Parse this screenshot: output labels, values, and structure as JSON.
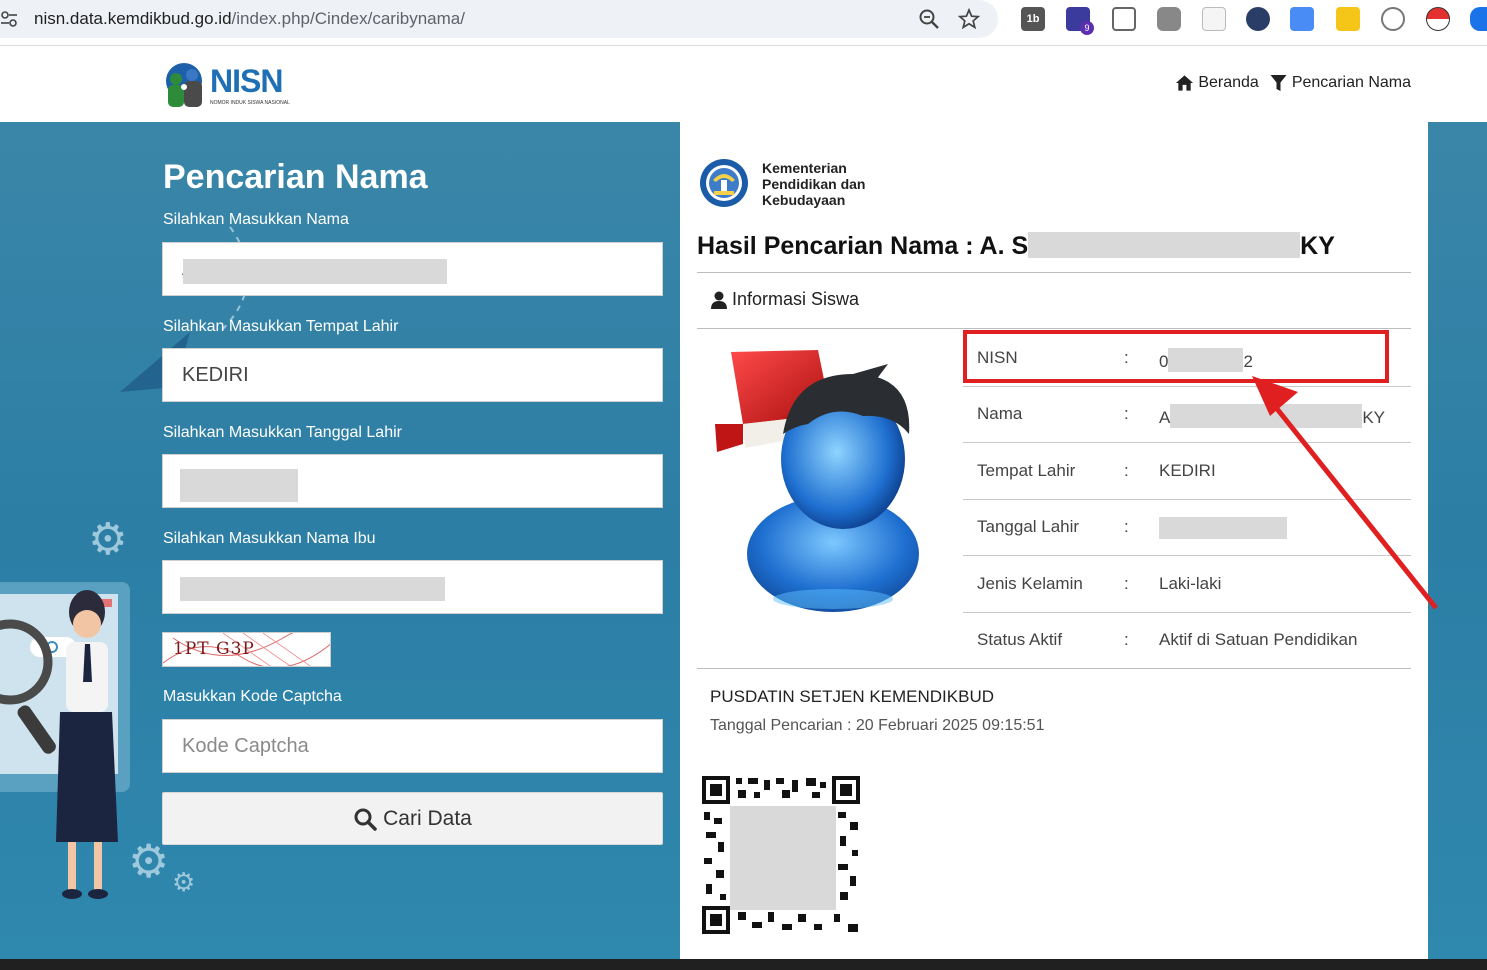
{
  "browser": {
    "url_host": "nisn.data.kemdikbud.go.id",
    "url_path": "/index.php/Cindex/caribynama/",
    "extensions": [
      "1b",
      "9"
    ]
  },
  "header": {
    "logo_text": "NISN",
    "logo_sub": "NOMOR INDUK SISWA NASIONAL",
    "nav": [
      {
        "label": "Beranda",
        "icon": "home-icon"
      },
      {
        "label": "Pencarian Nama",
        "icon": "filter-icon"
      }
    ]
  },
  "form": {
    "title": "Pencarian Nama",
    "name_label": "Silahkan Masukkan Nama",
    "name_value": "A",
    "birthplace_label": "Silahkan Masukkan Tempat Lahir",
    "birthplace_value": "KEDIRI",
    "birthdate_label": "Silahkan Masukkan Tanggal Lahir",
    "mother_label": "Silahkan Masukkan Nama Ibu",
    "captcha_image_text": "1PT G3P",
    "captcha_label": "Masukkan Kode Captcha",
    "captcha_placeholder": "Kode Captcha",
    "search_button": "Cari Data"
  },
  "result": {
    "ministry": "Kementerian Pendidikan dan Kebudayaan",
    "title_prefix": "Hasil Pencarian Nama : A. S",
    "title_suffix": "KY",
    "section": "Informasi Siswa",
    "rows": [
      {
        "key": "NISN",
        "value_prefix": "0",
        "value_suffix": "2"
      },
      {
        "key": "Nama",
        "value_prefix": "A",
        "value_suffix": "KY"
      },
      {
        "key": "Tempat Lahir",
        "value": "KEDIRI"
      },
      {
        "key": "Tanggal Lahir",
        "value": ""
      },
      {
        "key": "Jenis Kelamin",
        "value": "Laki-laki"
      },
      {
        "key": "Status Aktif",
        "value": "Aktif di Satuan Pendidikan"
      }
    ],
    "org": "PUSDATIN SETJEN KEMENDIKBUD",
    "search_date": "Tanggal Pencarian : 20 Februari 2025 09:15:51"
  },
  "colors": {
    "accent": "#2c7ea5",
    "highlight": "#e02020",
    "brand": "#1f6fb5"
  }
}
